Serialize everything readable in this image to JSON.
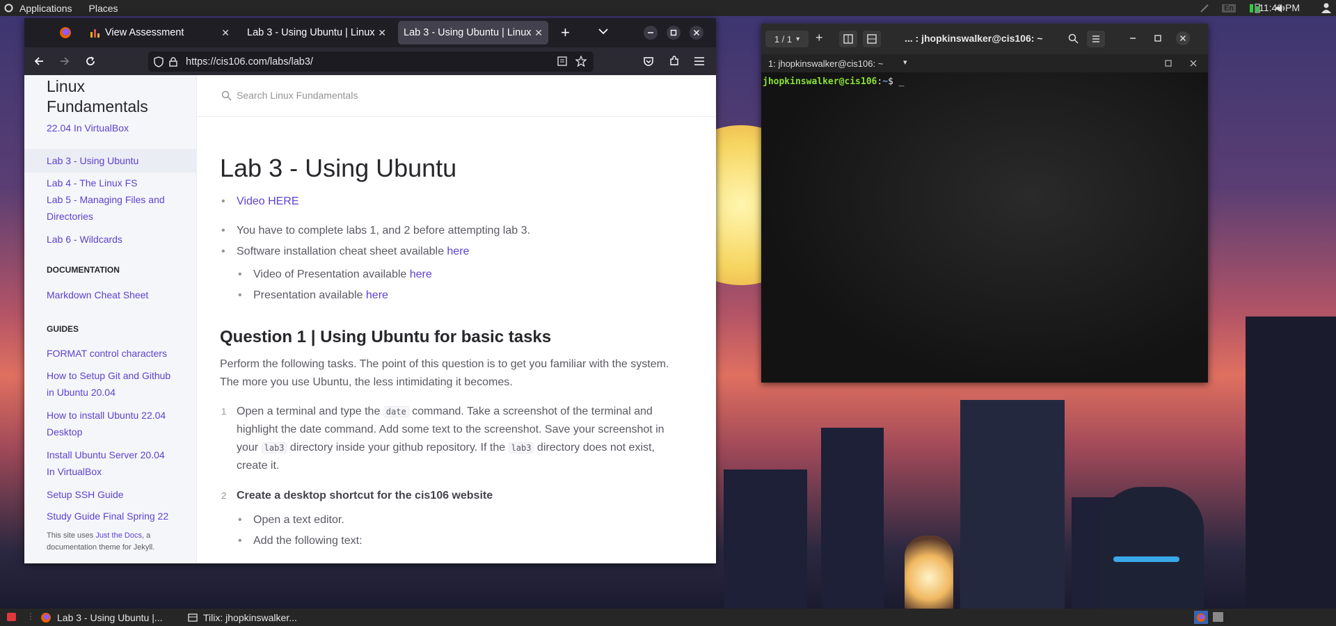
{
  "topbar": {
    "applications": "Applications",
    "places": "Places",
    "clock": "11:40 PM",
    "keyboard_layout": "En"
  },
  "firefox": {
    "tabs": [
      {
        "label": "View Assessment"
      },
      {
        "label": "Lab 3 - Using Ubuntu | Linux"
      },
      {
        "label": "Lab 3 - Using Ubuntu | Linux"
      }
    ],
    "new_tab": "+",
    "url": "https://cis106.com/labs/lab3/"
  },
  "site": {
    "brand_line1": "Linux",
    "brand_line2": "Fundamentals",
    "search_placeholder": "Search Linux Fundamentals",
    "nav": [
      {
        "label": "22.04 In VirtualBox"
      },
      {
        "label": "Lab 3 - Using Ubuntu"
      },
      {
        "label": "Lab 4 - The Linux FS"
      },
      {
        "label": "Lab 5 - Managing Files and"
      },
      {
        "label": "Directories"
      },
      {
        "label": "Lab 6 - Wildcards"
      }
    ],
    "documentation_heading": "DOCUMENTATION",
    "documentation_links": [
      {
        "label": "Markdown Cheat Sheet"
      }
    ],
    "guides_heading": "GUIDES",
    "guides": [
      {
        "label": "FORMAT control characters"
      },
      {
        "label": "How to Setup Git and Github"
      },
      {
        "label": "in Ubuntu 20.04"
      },
      {
        "label": "How to install Ubuntu 22.04"
      },
      {
        "label": "Desktop"
      },
      {
        "label": "Install Ubuntu Server 20.04"
      },
      {
        "label": "In VirtualBox"
      },
      {
        "label": "Setup SSH Guide"
      },
      {
        "label": "Study Guide Final Spring 22"
      }
    ],
    "footer_prefix": "This site uses ",
    "footer_link": "Just the Docs",
    "footer_suffix": ", a documentation theme for Jekyll."
  },
  "content": {
    "title": "Lab 3 - Using Ubuntu",
    "video_link": "Video HERE",
    "prereq": "You have to complete labs 1, and 2 before attempting lab 3.",
    "cheatsheet_text": "Software installation cheat sheet available ",
    "here": "here",
    "video_presentation_text": "Video of Presentation available ",
    "presentation_text": "Presentation available ",
    "q1_heading": "Question 1 | Using Ubuntu for basic tasks",
    "q1_intro_line1": "Perform the following tasks. The point of this question is to get you familiar with the system.",
    "q1_intro_line2": "The more you use Ubuntu, the less intimidating it becomes.",
    "step1_num": "1",
    "step1_a": "Open a terminal and type the ",
    "step1_code1": "date",
    "step1_b": " command. Take a screenshot of the terminal and",
    "step1_line2": "highlight the date command. Add some text to the screenshot. Save your screenshot in",
    "step1_c": "your ",
    "step1_code2": "lab3",
    "step1_d": " directory inside your github repository. If the ",
    "step1_code3": "lab3",
    "step1_e": " directory does not exist,",
    "step1_line4": "create it.",
    "step2_num": "2",
    "step2_title": "Create a desktop shortcut for the cis106 website",
    "step2_items": [
      "Open a text editor.",
      "Add the following text:"
    ]
  },
  "terminal": {
    "session_counter": "1 / 1",
    "title": "... : jhopkinswalker@cis106: ~",
    "subtitle": "1: jhopkinswalker@cis106: ~",
    "prompt_user": "jhopkinswalker@cis106",
    "prompt_sep": ":",
    "prompt_path": "~",
    "prompt_symbol": "$ _"
  },
  "taskbar": {
    "items": [
      {
        "label": "Lab 3 - Using Ubuntu |..."
      },
      {
        "label": "Tilix: jhopkinswalker..."
      }
    ]
  },
  "colors": {
    "link": "#5e41d0",
    "prompt_green": "#8ae234",
    "prompt_blue": "#729fcf"
  }
}
